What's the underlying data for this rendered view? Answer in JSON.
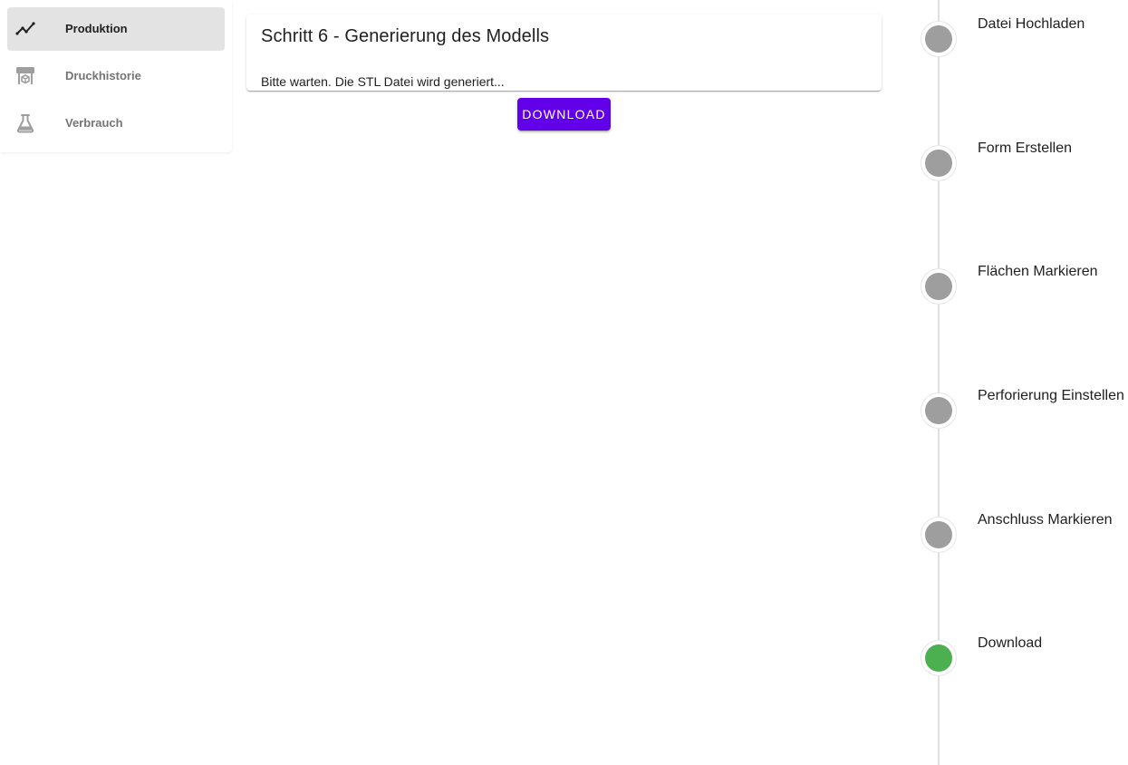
{
  "sidebar": {
    "items": [
      {
        "label": "Produktion",
        "icon": "chart-line-icon",
        "active": true
      },
      {
        "label": "Druckhistorie",
        "icon": "printer-3d-icon",
        "active": false
      },
      {
        "label": "Verbrauch",
        "icon": "flask-icon",
        "active": false
      }
    ]
  },
  "main": {
    "card_title": "Schritt 6 - Generierung des Modells",
    "card_text": "Bitte warten. Die STL Datei wird generiert...",
    "download_label": "DOWNLOAD"
  },
  "timeline": {
    "steps": [
      {
        "label": "Datei Hochladen",
        "status": "inactive"
      },
      {
        "label": "Form Erstellen",
        "status": "inactive"
      },
      {
        "label": "Flächen Markieren",
        "status": "inactive"
      },
      {
        "label": "Perforierung Einstellen",
        "status": "inactive"
      },
      {
        "label": "Anschluss Markieren",
        "status": "inactive"
      },
      {
        "label": "Download",
        "status": "active"
      }
    ]
  },
  "colors": {
    "accent": "#6200ea",
    "step_inactive": "#9e9e9e",
    "step_active": "#4caf50",
    "nav_active_bg": "#e3e3e3"
  }
}
